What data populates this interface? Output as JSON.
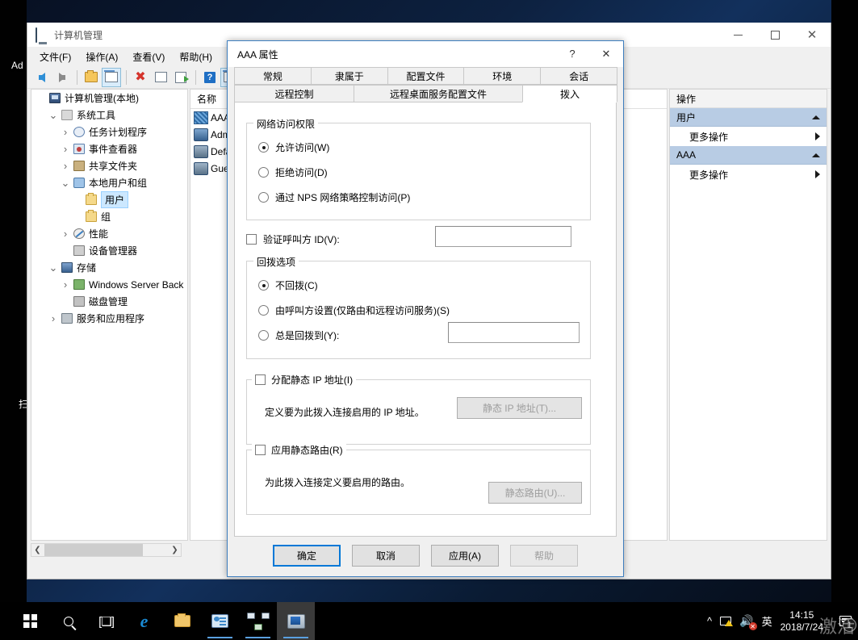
{
  "desktop": {
    "icon_labels": [
      "Ad",
      "扫"
    ]
  },
  "computer_management": {
    "title": "计算机管理",
    "icon": "mmc-console-icon",
    "window_buttons": {
      "minimize": "minimize-icon",
      "maximize": "maximize-icon",
      "close": "close-icon"
    },
    "menus": [
      "文件(F)",
      "操作(A)",
      "查看(V)",
      "帮助(H)"
    ],
    "toolbar_icons": [
      "back-arrow-icon",
      "forward-arrow-icon",
      "up-folder-icon",
      "show-hide-tree-icon",
      "delete-icon",
      "properties-icon",
      "export-list-icon",
      "help-icon",
      "show-action-pane-icon"
    ],
    "tree": [
      {
        "label": "计算机管理(本地)",
        "twisty": "",
        "icon": "computer-icon",
        "indent": 0,
        "selected": false
      },
      {
        "label": "系统工具",
        "twisty": "v",
        "icon": "system-tools-icon",
        "indent": 1,
        "selected": false
      },
      {
        "label": "任务计划程序",
        "twisty": ">",
        "icon": "task-scheduler-icon",
        "indent": 2,
        "selected": false
      },
      {
        "label": "事件查看器",
        "twisty": ">",
        "icon": "event-viewer-icon",
        "indent": 2,
        "selected": false
      },
      {
        "label": "共享文件夹",
        "twisty": ">",
        "icon": "shared-folders-icon",
        "indent": 2,
        "selected": false
      },
      {
        "label": "本地用户和组",
        "twisty": "v",
        "icon": "local-users-groups-icon",
        "indent": 2,
        "selected": false
      },
      {
        "label": "用户",
        "twisty": "",
        "icon": "folder-icon",
        "indent": 3,
        "selected": true
      },
      {
        "label": "组",
        "twisty": "",
        "icon": "folder-icon",
        "indent": 3,
        "selected": false
      },
      {
        "label": "性能",
        "twisty": ">",
        "icon": "performance-icon",
        "indent": 2,
        "selected": false
      },
      {
        "label": "设备管理器",
        "twisty": "",
        "icon": "device-manager-icon",
        "indent": 2,
        "selected": false
      },
      {
        "label": "存储",
        "twisty": "v",
        "icon": "storage-icon",
        "indent": 1,
        "selected": false
      },
      {
        "label": "Windows Server Back",
        "twisty": ">",
        "icon": "windows-server-backup-icon",
        "indent": 2,
        "selected": false
      },
      {
        "label": "磁盘管理",
        "twisty": "",
        "icon": "disk-management-icon",
        "indent": 2,
        "selected": false
      },
      {
        "label": "服务和应用程序",
        "twisty": ">",
        "icon": "services-applications-icon",
        "indent": 1,
        "selected": false
      }
    ],
    "list": {
      "columns": [
        "名称"
      ],
      "rows": [
        {
          "name": "AAA",
          "icon": "user-aaa-icon"
        },
        {
          "name": "Admi",
          "icon": "user-icon"
        },
        {
          "name": "Defa",
          "icon": "user-disabled-icon"
        },
        {
          "name": "Gues",
          "icon": "user-disabled-icon"
        }
      ]
    },
    "actions": {
      "title": "操作",
      "groups": [
        {
          "header": "用户",
          "items": [
            "更多操作"
          ]
        },
        {
          "header": "AAA",
          "items": [
            "更多操作"
          ]
        }
      ]
    },
    "hscroll": {
      "left_arrow": "scroll-left-icon",
      "right_arrow": "scroll-right-icon"
    }
  },
  "dialog": {
    "title": "AAA 属性",
    "help_button": "?",
    "close_button": "✕",
    "tabs_row1": [
      "常规",
      "隶属于",
      "配置文件",
      "环境",
      "会话"
    ],
    "tabs_row2": [
      "远程控制",
      "远程桌面服务配置文件",
      "拨入"
    ],
    "active_tab": "拨入",
    "network_access": {
      "group_label": "网络访问权限",
      "options": [
        {
          "label": "允许访问(W)",
          "selected": true
        },
        {
          "label": "拒绝访问(D)",
          "selected": false
        },
        {
          "label": "通过 NPS 网络策略控制访问(P)",
          "selected": false
        }
      ]
    },
    "verify_caller_id": {
      "label": "验证呼叫方 ID(V):",
      "checked": false,
      "value": ""
    },
    "callback": {
      "group_label": "回拨选项",
      "options": [
        {
          "label": "不回拨(C)",
          "selected": true
        },
        {
          "label": "由呼叫方设置(仅路由和远程访问服务)(S)",
          "selected": false
        },
        {
          "label": "总是回拨到(Y):",
          "selected": false
        }
      ],
      "callback_value": ""
    },
    "static_ip": {
      "group_label": "分配静态 IP 地址(I)",
      "checked": false,
      "description": "定义要为此拨入连接启用的 IP 地址。",
      "button": "静态 IP 地址(T)...",
      "button_disabled": true
    },
    "static_routes": {
      "group_label": "应用静态路由(R)",
      "checked": false,
      "description": "为此拨入连接定义要启用的路由。",
      "button": "静态路由(U)...",
      "button_disabled": true
    },
    "footer": {
      "ok": "确定",
      "cancel": "取消",
      "apply": "应用(A)",
      "help": "帮助",
      "help_disabled": true
    }
  },
  "taskbar": {
    "items": [
      {
        "name": "start",
        "icon": "windows-logo-icon",
        "active": false,
        "running": false
      },
      {
        "name": "search",
        "icon": "search-icon",
        "active": false,
        "running": false
      },
      {
        "name": "task-view",
        "icon": "task-view-icon",
        "active": false,
        "running": false
      },
      {
        "name": "internet-explorer",
        "icon": "internet-explorer-icon",
        "active": false,
        "running": false
      },
      {
        "name": "file-explorer",
        "icon": "file-explorer-icon",
        "active": false,
        "running": false
      },
      {
        "name": "mmc-console",
        "icon": "mmc-console-icon",
        "active": false,
        "running": true
      },
      {
        "name": "network-connections",
        "icon": "network-icon",
        "active": false,
        "running": true
      },
      {
        "name": "computer-management",
        "icon": "computer-management-icon",
        "active": true,
        "running": true
      }
    ],
    "tray": {
      "chevron": "^",
      "network_icon": "network-warning-icon",
      "volume_icon": "volume-muted-icon",
      "ime": "英",
      "time": "14:15",
      "date": "2018/7/24",
      "notifications_icon": "notifications-icon",
      "notification_count": "1"
    },
    "watermark": "激活"
  }
}
